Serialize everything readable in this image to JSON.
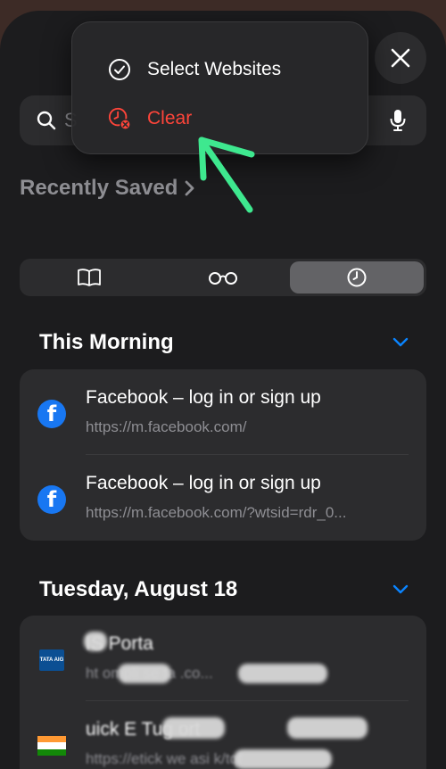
{
  "search": {
    "visible_text": "S"
  },
  "menu": {
    "select_label": "Select Websites",
    "clear_label": "Clear"
  },
  "recently_saved": "Recently Saved",
  "segments": [
    {
      "name": "bookmarks-icon",
      "active": false
    },
    {
      "name": "reading-list-icon",
      "active": false
    },
    {
      "name": "history-icon",
      "active": true
    }
  ],
  "sections": [
    {
      "title": "This Morning",
      "items": [
        {
          "title": "Facebook – log in or sign up",
          "url": "https://m.facebook.com/",
          "icon": "facebook-icon"
        },
        {
          "title": "Facebook – log in or sign up",
          "url": "https://m.facebook.com/?wtsid=rdr_0...",
          "icon": "facebook-icon"
        }
      ]
    },
    {
      "title": "Tuesday, August 18",
      "items": [
        {
          "title": "IS Porta",
          "url": "ht        ompli    se       ta   .co...",
          "icon": "tata-aig-icon",
          "logo_text": "TATA AIG"
        },
        {
          "title": "uick E          Tug          ort",
          "url": "https://etick   we          asi   k/tqf",
          "icon": "india-flag-icon"
        }
      ]
    }
  ],
  "colors": {
    "background": "#1c1c1e",
    "card": "#2c2c2e",
    "accent": "#0a84ff",
    "destructive": "#ff453a",
    "annotation_arrow": "#3ee88f"
  }
}
